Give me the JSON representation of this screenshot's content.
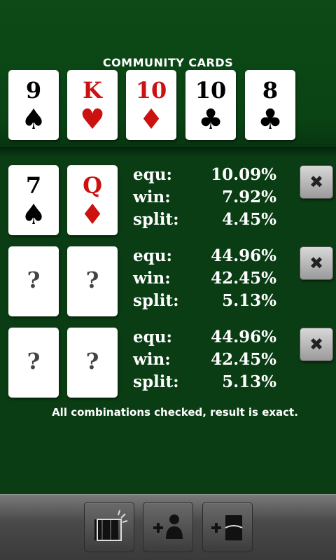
{
  "community": {
    "title": "COMMUNITY CARDS",
    "cards": [
      {
        "rank": "9",
        "suit": "♠",
        "color": "black"
      },
      {
        "rank": "K",
        "suit": "♥",
        "color": "red"
      },
      {
        "rank": "10",
        "suit": "♦",
        "color": "red"
      },
      {
        "rank": "10",
        "suit": "♣",
        "color": "black"
      },
      {
        "rank": "8",
        "suit": "♣",
        "color": "black"
      }
    ]
  },
  "players": [
    {
      "cards": [
        {
          "rank": "7",
          "suit": "♠",
          "color": "black"
        },
        {
          "rank": "Q",
          "suit": "♦",
          "color": "red"
        }
      ],
      "equ_label": "equ:",
      "equ": "10.09%",
      "win_label": "win:",
      "win": "7.92%",
      "split_label": "split:",
      "split": "4.45%",
      "remove_label": "✖"
    },
    {
      "cards": [
        {
          "rank": "?"
        },
        {
          "rank": "?"
        }
      ],
      "equ_label": "equ:",
      "equ": "44.96%",
      "win_label": "win:",
      "win": "42.45%",
      "split_label": "split:",
      "split": "5.13%",
      "remove_label": "✖"
    },
    {
      "cards": [
        {
          "rank": "?"
        },
        {
          "rank": "?"
        }
      ],
      "equ_label": "equ:",
      "equ": "44.96%",
      "win_label": "win:",
      "win": "42.45%",
      "split_label": "split:",
      "split": "5.13%",
      "remove_label": "✖"
    }
  ],
  "status": "All combinations checked, result is exact.",
  "toolbar": {
    "buttons": [
      {
        "icon": "deck-shuffle-icon"
      },
      {
        "icon": "add-player-icon"
      },
      {
        "icon": "add-card-icon"
      }
    ]
  },
  "colors": {
    "felt": "#0a3d13",
    "red_suit": "#cc1111",
    "black_suit": "#000000"
  }
}
